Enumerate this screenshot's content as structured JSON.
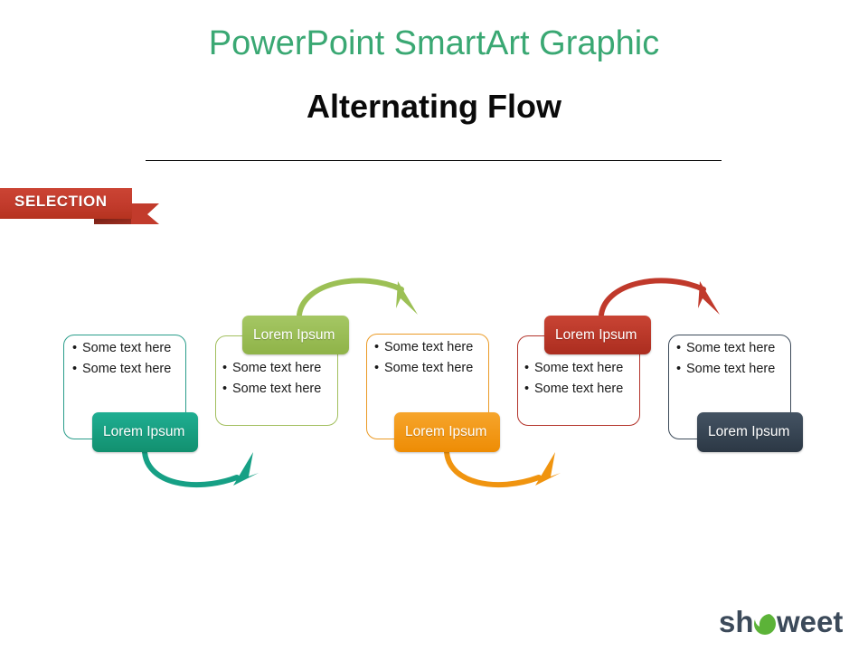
{
  "header": {
    "title": "PowerPoint SmartArt Graphic",
    "subtitle": "Alternating Flow",
    "title_color": "#3aa873",
    "subtitle_color": "#0a0a0a"
  },
  "ribbon": {
    "label": "SELECTION",
    "color": "#c23b2c",
    "fold_color": "#8e2a1e"
  },
  "diagram": {
    "type": "alternating-flow",
    "steps": [
      {
        "index": 1,
        "label": "Lorem Ipsum",
        "label_position": "bottom",
        "color": "#16a085",
        "outline_color": "#2a9d8a",
        "bullets": [
          "Some text here",
          "Some text here"
        ]
      },
      {
        "index": 2,
        "label": "Lorem Ipsum",
        "label_position": "top",
        "color": "#9cc055",
        "outline_color": "#a2bf5e",
        "bullets": [
          "Some text here",
          "Some text here"
        ]
      },
      {
        "index": 3,
        "label": "Lorem Ipsum",
        "label_position": "bottom",
        "color": "#f0940f",
        "outline_color": "#eb9b26",
        "bullets": [
          "Some text here",
          "Some text here"
        ]
      },
      {
        "index": 4,
        "label": "Lorem Ipsum",
        "label_position": "top",
        "color": "#c0392b",
        "outline_color": "#b3332a",
        "bullets": [
          "Some text here",
          "Some text here"
        ]
      },
      {
        "index": 5,
        "label": "Lorem Ipsum",
        "label_position": "bottom",
        "color": "#3b4a5a",
        "outline_color": "#3c4a59",
        "bullets": [
          "Some text here",
          "Some text here"
        ]
      }
    ],
    "connectors": [
      {
        "from": 1,
        "to": 2,
        "direction": "down-arc",
        "color": "#16a085"
      },
      {
        "from": 2,
        "to": 3,
        "direction": "up-arc",
        "color": "#9cc055"
      },
      {
        "from": 3,
        "to": 4,
        "direction": "down-arc",
        "color": "#f0940f"
      },
      {
        "from": 4,
        "to": 5,
        "direction": "up-arc",
        "color": "#c0392b"
      }
    ]
  },
  "branding": {
    "name": "showeet",
    "name_before": "sh",
    "name_after": "weet",
    "text_color": "#3c4a5a",
    "mark_color": "#5cb338"
  }
}
